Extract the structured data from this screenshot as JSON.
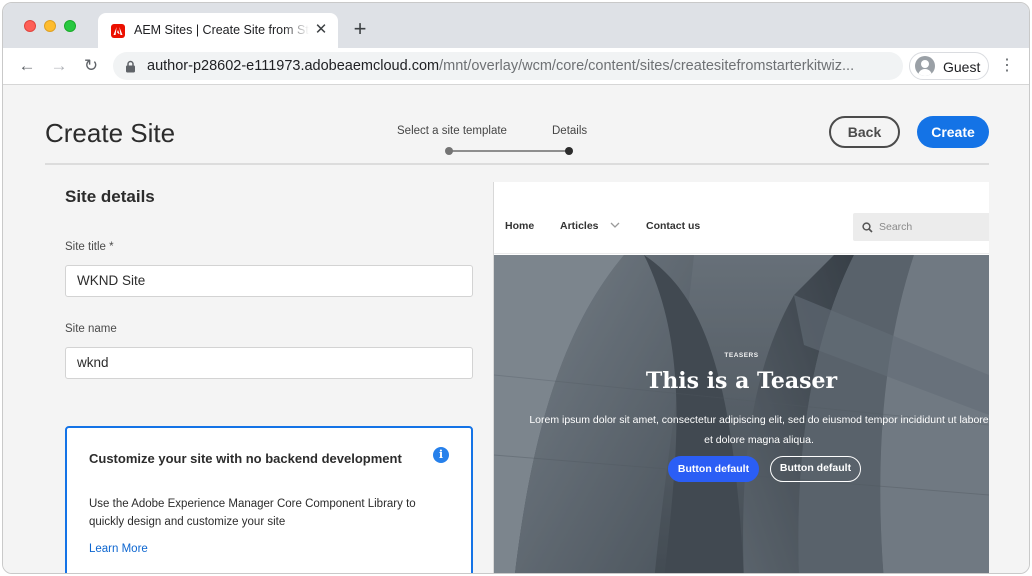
{
  "browser": {
    "tab_title": "AEM Sites | Create Site from Starter Kit",
    "new_tab_symbol": "+",
    "close_symbol": "✕",
    "url_host": "author-p28602-e111973.adobeaemcloud.com",
    "url_path": "/mnt/overlay/wcm/core/content/sites/createsitefromstarterkitwiz...",
    "profile_label": "Guest",
    "back_symbol": "←",
    "forward_symbol": "→",
    "reload_symbol": "↻",
    "menu_symbol": "⋮"
  },
  "header": {
    "title": "Create Site",
    "steps": [
      {
        "label": "Select a site template",
        "completed": true
      },
      {
        "label": "Details",
        "current": true
      }
    ],
    "back_label": "Back",
    "create_label": "Create"
  },
  "colors": {
    "accent": "#1473e6",
    "preview_button": "#2b5ef5"
  },
  "form": {
    "section_title": "Site details",
    "site_title_label": "Site title *",
    "site_title_value": "WKND Site",
    "site_name_label": "Site name",
    "site_name_value": "wknd"
  },
  "info_card": {
    "title": "Customize your site with no backend development",
    "icon": "info-icon",
    "body": "Use the Adobe Experience Manager Core Component Library to quickly design and customize your site",
    "link": "Learn More"
  },
  "preview": {
    "nav": [
      "Home",
      "Articles",
      "Contact us"
    ],
    "search_placeholder": "Search",
    "eyebrow": "TEASERS",
    "heading": "This is a Teaser",
    "text": "Lorem ipsum dolor sit amet, consectetur adipiscing elit, sed do eiusmod tempor incididunt ut labore et dolore magna aliqua.",
    "primary_button": "Button default",
    "secondary_button": "Button default"
  }
}
